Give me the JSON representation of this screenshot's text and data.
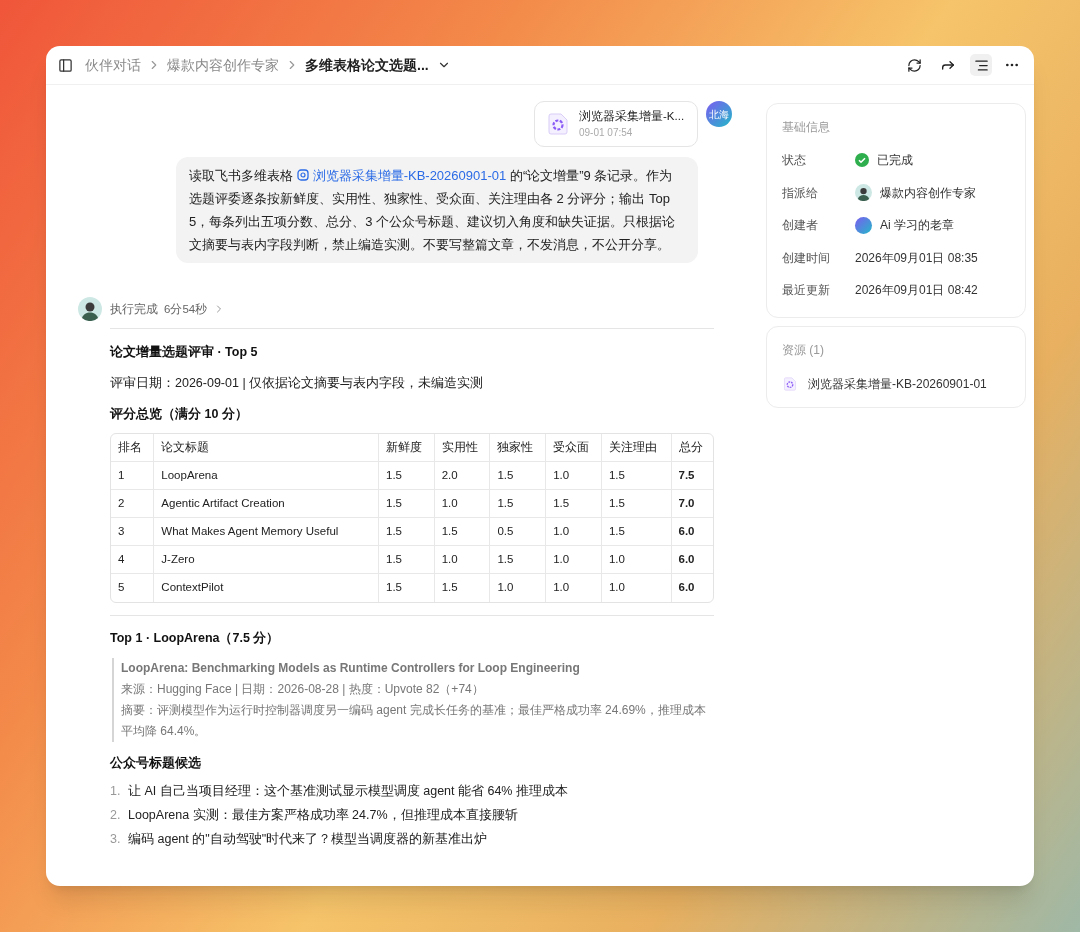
{
  "header": {
    "breadcrumbs": [
      {
        "label": "伙伴对话",
        "current": false
      },
      {
        "label": "爆款内容创作专家",
        "current": false
      },
      {
        "label": "多维表格论文选题...",
        "current": true
      }
    ],
    "outline_button_on": true
  },
  "user_message": {
    "avatar_text": "北海",
    "attachment": {
      "name": "浏览器采集增量-K...",
      "time": "09-01 07:54"
    },
    "text_before": "读取飞书多维表格",
    "link": "浏览器采集增量-KB-20260901-01",
    "text_after": "的“论文增量”9 条记录。作为选题评委逐条按新鲜度、实用性、独家性、受众面、关注理由各 2 分评分；输出 Top 5，每条列出五项分数、总分、3 个公众号标题、建议切入角度和缺失证据。只根据论文摘要与表内字段判断，禁止编造实测。不要写整篇文章，不发消息，不公开分享。"
  },
  "run": {
    "status": "执行完成",
    "duration": "6分54秒"
  },
  "report": {
    "title": "论文增量选题评审 · Top 5",
    "meta": "评审日期：2026-09-01 | 仅依据论文摘要与表内字段，未编造实测",
    "overview_heading": "评分总览（满分 10 分）",
    "table": {
      "columns": [
        "排名",
        "论文标题",
        "新鲜度",
        "实用性",
        "独家性",
        "受众面",
        "关注理由",
        "总分"
      ],
      "rows": [
        [
          "1",
          "LoopArena",
          "1.5",
          "2.0",
          "1.5",
          "1.0",
          "1.5",
          "7.5"
        ],
        [
          "2",
          "Agentic Artifact Creation",
          "1.5",
          "1.0",
          "1.5",
          "1.5",
          "1.5",
          "7.0"
        ],
        [
          "3",
          "What Makes Agent Memory Useful",
          "1.5",
          "1.5",
          "0.5",
          "1.0",
          "1.5",
          "6.0"
        ],
        [
          "4",
          "J-Zero",
          "1.5",
          "1.0",
          "1.5",
          "1.0",
          "1.0",
          "6.0"
        ],
        [
          "5",
          "ContextPilot",
          "1.5",
          "1.5",
          "1.0",
          "1.0",
          "1.0",
          "6.0"
        ]
      ]
    },
    "top1_heading": "Top 1 · LoopArena（7.5 分）",
    "quote": {
      "title": "LoopArena: Benchmarking Models as Runtime Controllers for Loop Engineering",
      "source": "来源：Hugging Face | 日期：2026-08-28 | 热度：Upvote 82（+74）",
      "summary": "摘要：评测模型作为运行时控制器调度另一编码 agent 完成长任务的基准；最佳严格成功率 24.69%，推理成本平均降 64.4%。"
    },
    "titles_heading": "公众号标题候选",
    "titles": [
      {
        "marker": "1.",
        "text": "让 AI 自己当项目经理：这个基准测试显示模型调度 agent 能省 64% 推理成本"
      },
      {
        "marker": "2.",
        "text": "LoopArena 实测：最佳方案严格成功率 24.7%，但推理成本直接腰斩"
      },
      {
        "marker": "3.",
        "text": "编码 agent 的\"自动驾驶\"时代来了？模型当调度器的新基准出炉"
      }
    ]
  },
  "info": {
    "heading": "基础信息",
    "fields": [
      {
        "kind": "status",
        "label": "状态",
        "value": "已完成"
      },
      {
        "kind": "agent",
        "label": "指派给",
        "value": "爆款内容创作专家"
      },
      {
        "kind": "user",
        "label": "创建者",
        "value": "Ai 学习的老章"
      },
      {
        "kind": "text",
        "label": "创建时间",
        "value": "2026年09月01日 08:35"
      },
      {
        "kind": "text",
        "label": "最近更新",
        "value": "2026年09月01日 08:42"
      }
    ]
  },
  "resources": {
    "heading": "资源 (1)",
    "items": [
      {
        "name": "浏览器采集增量-KB-20260901-01"
      }
    ]
  }
}
